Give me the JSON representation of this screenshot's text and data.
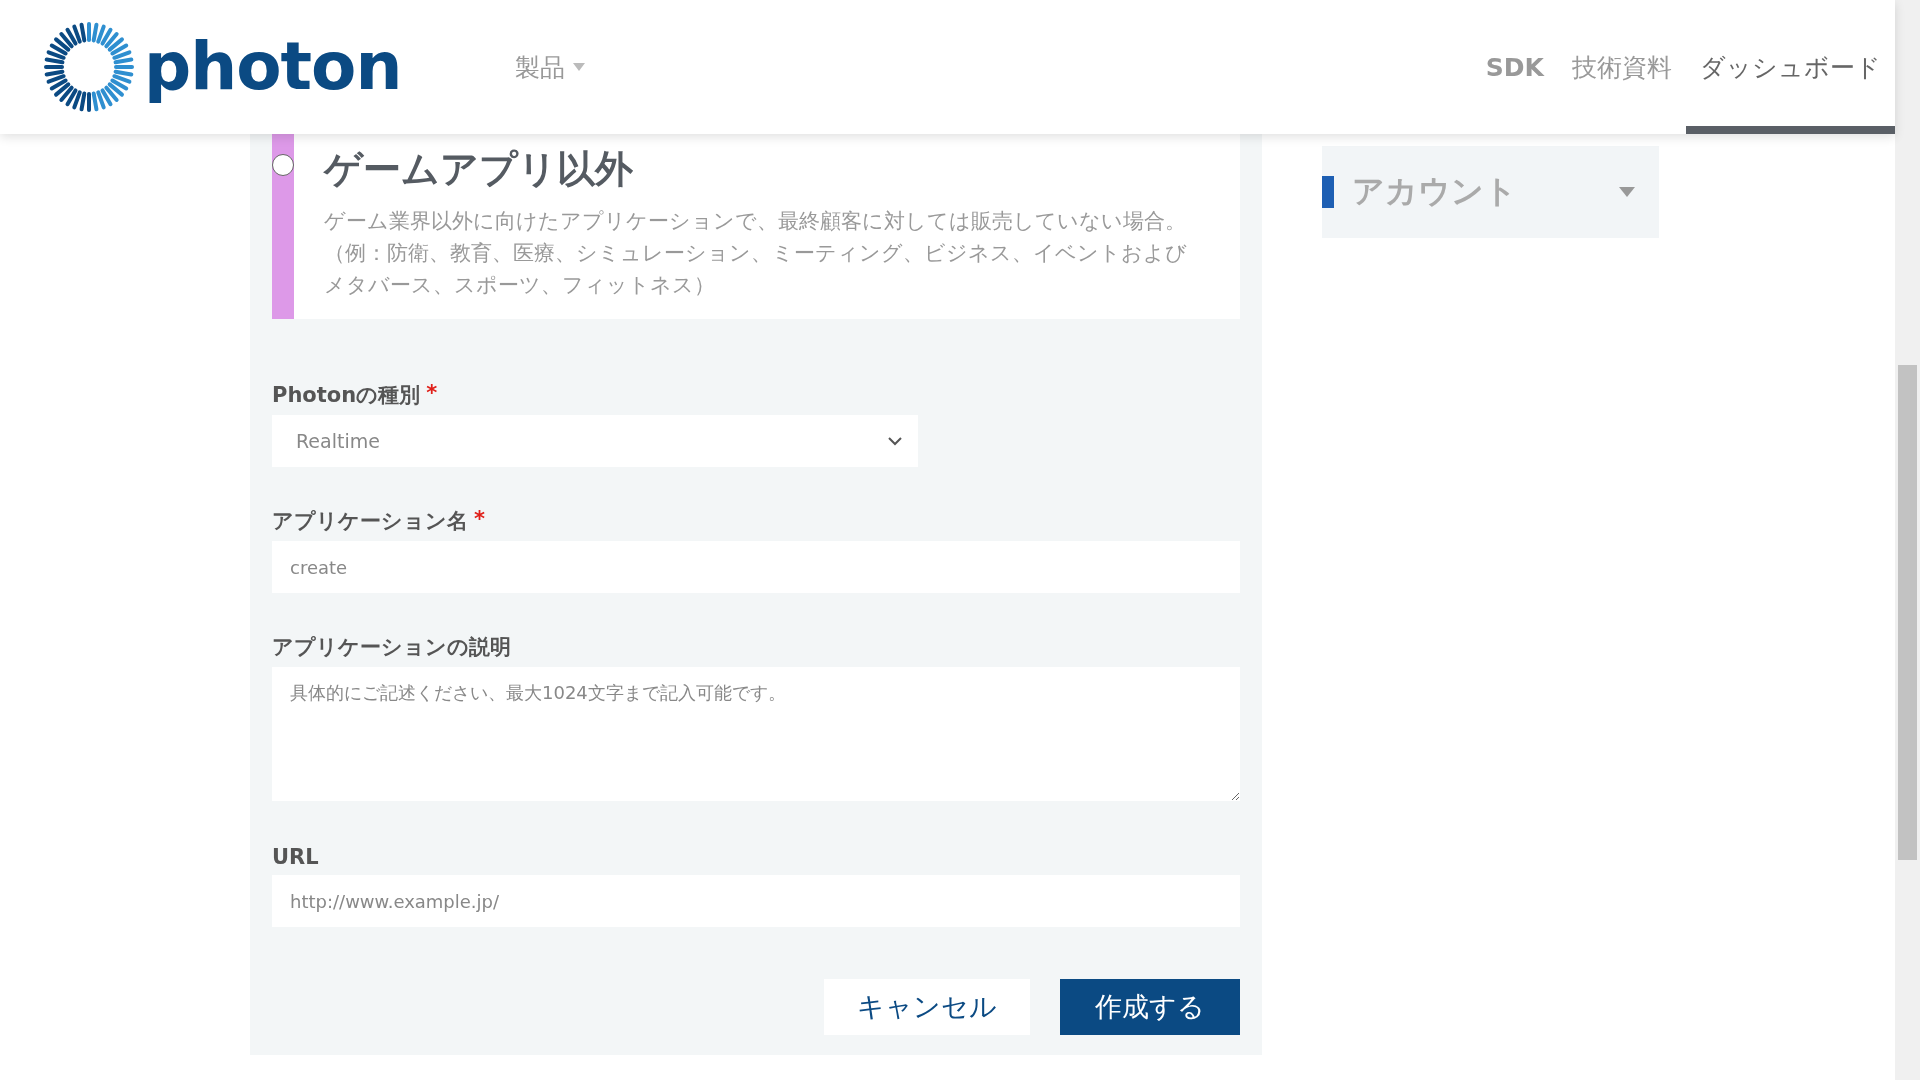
{
  "header": {
    "logo_text": "photon",
    "nav": [
      {
        "label": "製品",
        "kind": "dropdown",
        "selected": false
      },
      {
        "label": "SDK",
        "kind": "link",
        "selected": false
      },
      {
        "label": "技術資料",
        "kind": "link",
        "selected": false
      },
      {
        "label": "ダッシュボード",
        "kind": "link",
        "selected": true
      }
    ]
  },
  "option_card": {
    "title": "ゲームアプリ以外",
    "selected": false,
    "color": "#dd99e8",
    "description": "ゲーム業界以外に向けたアプリケーションで、最終顧客に対しては販売していない場合。（例：防衛、教育、医療、シミュレーション、ミーティング、ビジネス、イベントおよびメタバース、スポーツ、フィットネス）"
  },
  "form": {
    "fields": [
      {
        "label": "Photonの種別",
        "required_mark": "*",
        "kind": "select",
        "value": "Realtime"
      },
      {
        "label": "アプリケーション名",
        "required_mark": "*",
        "kind": "input",
        "placeholder": "create"
      },
      {
        "label": "アプリケーションの説明",
        "kind": "textarea",
        "placeholder": "具体的にご記述ください、最大1024文字まで記入可能です。"
      },
      {
        "label": "URL",
        "kind": "input",
        "placeholder": "http://www.example.jp/"
      }
    ],
    "buttons": [
      {
        "label": "キャンセル",
        "kind": "secondary"
      },
      {
        "label": "作成する",
        "kind": "primary"
      }
    ]
  },
  "sidebar": {
    "items": [
      {
        "label": "アカウント",
        "expanded": false
      }
    ]
  }
}
